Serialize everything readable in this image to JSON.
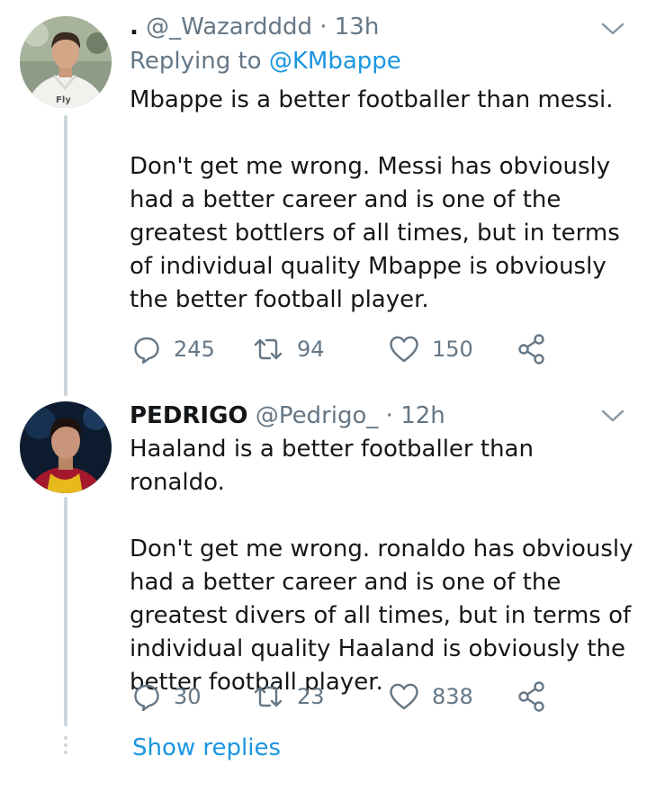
{
  "tweets": [
    {
      "display_name": ".",
      "handle": "@_Wazardddd",
      "separator": " · ",
      "time": "13h",
      "replying_label": "Replying to",
      "replying_to": "@KMbappe",
      "paragraphs": [
        "Mbappe is a better footballer than messi.",
        "Don't get me wrong. Messi has obviously had a better career and is one of the greatest bottlers of all times, but in terms of individual quality Mbappe is obviously the better football player."
      ],
      "replies": "245",
      "retweets": "94",
      "likes": "150",
      "avatar_icon": "player-in-white-training-shirt"
    },
    {
      "display_name": "PEDRIGO",
      "handle": "@Pedrigo_",
      "separator": " · ",
      "time": "12h",
      "paragraphs": [
        "Haaland is a better footballer than ronaldo.",
        "Don't get me wrong. ronaldo has obviously had a better career and is one of the greatest divers of all times, but in terms of individual quality Haaland is obviously the better football player."
      ],
      "replies": "30",
      "retweets": "23",
      "likes": "838",
      "avatar_icon": "player-portrait-dark-background"
    }
  ],
  "show_replies": "Show replies",
  "colors": {
    "link": "#1b95e0",
    "muted": "#657786",
    "thread_line": "#ccd6dd"
  }
}
